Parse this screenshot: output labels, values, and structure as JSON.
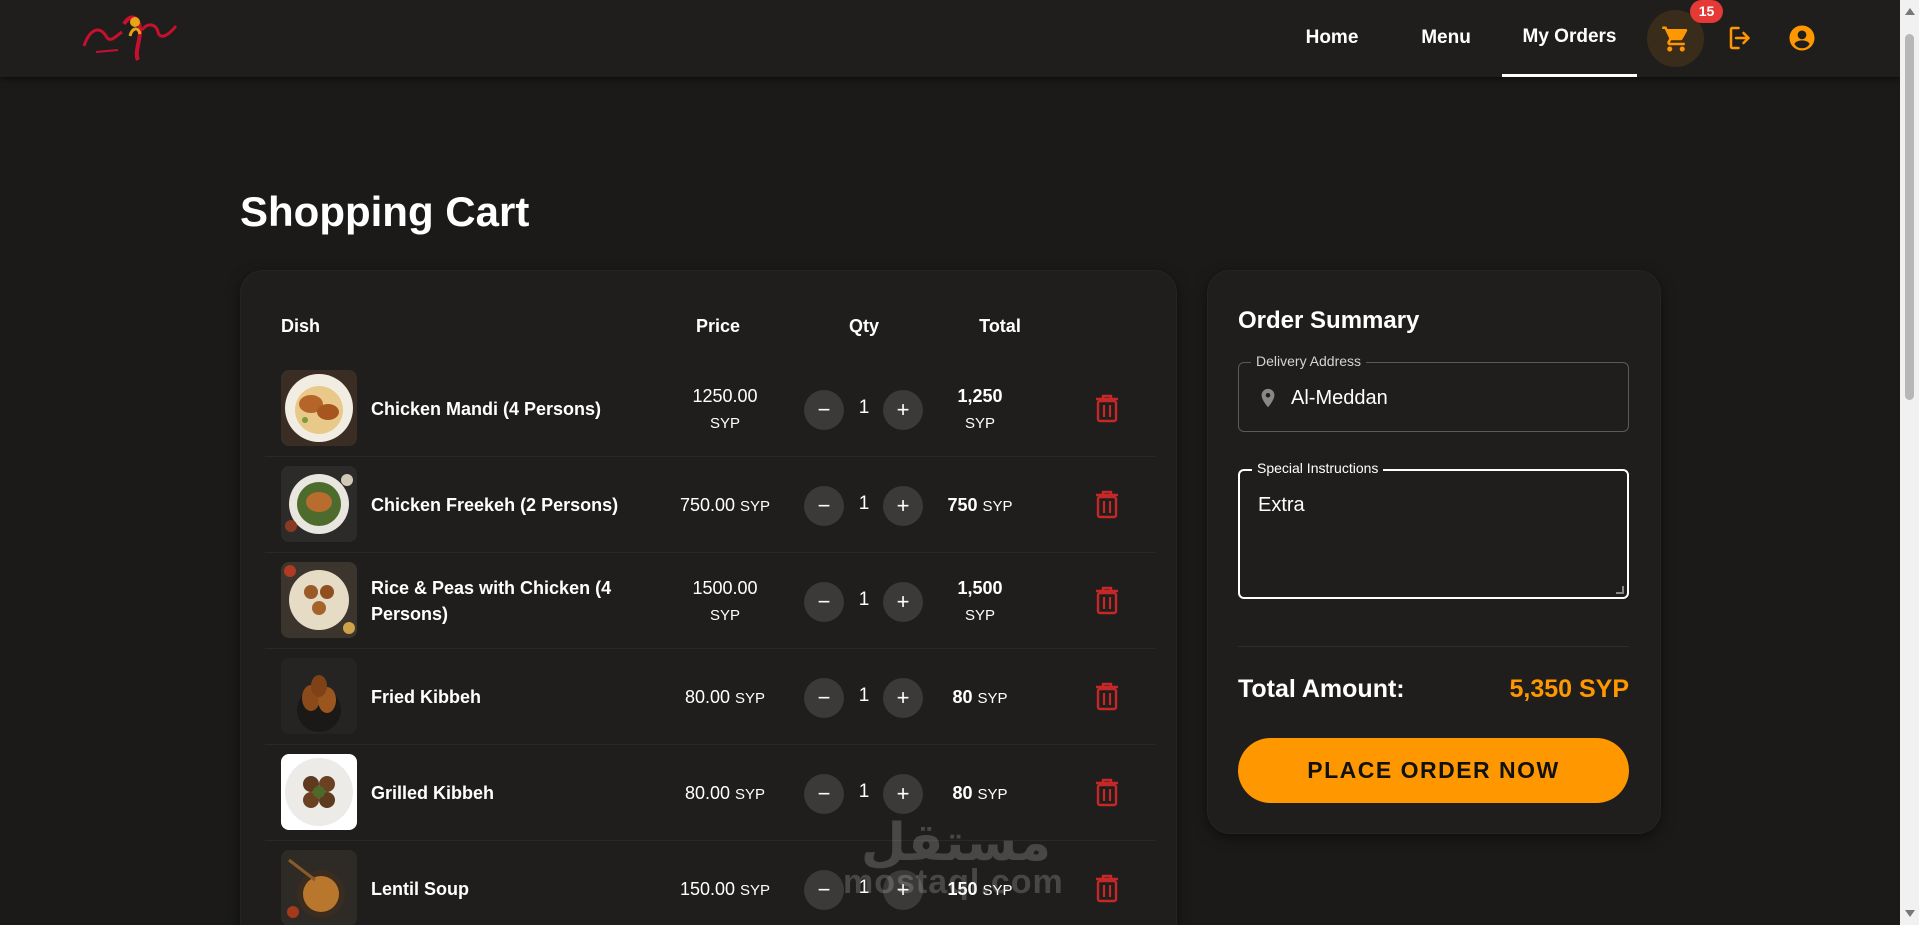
{
  "header": {
    "logo_alt": "restaurant-logo",
    "nav": [
      {
        "label": "Home"
      },
      {
        "label": "Menu"
      },
      {
        "label": "My Orders",
        "active": true
      }
    ],
    "cart_count": "15",
    "icons": [
      "cart-icon",
      "logout-icon",
      "account-circle-icon"
    ]
  },
  "page": {
    "title": "Shopping Cart"
  },
  "cart": {
    "columns": {
      "dish": "Dish",
      "price": "Price",
      "qty": "Qty",
      "total": "Total"
    },
    "currency": "SYP",
    "items": [
      {
        "name": "Chicken Mandi (4 Persons)",
        "price": "1250.00",
        "qty": "1",
        "total": "1,250"
      },
      {
        "name": "Chicken Freekeh (2 Persons)",
        "price": "750.00",
        "qty": "1",
        "total": "750"
      },
      {
        "name": "Rice & Peas with Chicken (4 Persons)",
        "price": "1500.00",
        "qty": "1",
        "total": "1,500"
      },
      {
        "name": "Fried Kibbeh",
        "price": "80.00",
        "qty": "1",
        "total": "80"
      },
      {
        "name": "Grilled Kibbeh",
        "price": "80.00",
        "qty": "1",
        "total": "80"
      },
      {
        "name": "Lentil Soup",
        "price": "150.00",
        "qty": "1",
        "total": "150"
      }
    ],
    "minus": "−",
    "plus": "+"
  },
  "summary": {
    "title": "Order Summary",
    "address_label": "Delivery Address",
    "address_value": "Al-Meddan",
    "instructions_label": "Special Instructions",
    "instructions_value": "Extra",
    "total_label": "Total Amount:",
    "total_value": "5,350 SYP",
    "place_order_label": "PLACE ORDER NOW"
  },
  "watermark": {
    "arabic": "مستقل",
    "latin": "mostaql.com"
  },
  "colors": {
    "background": "#1b1a19",
    "panel": "#1f1e1d",
    "accent": "#ff9800",
    "danger": "#c62828",
    "badge": "#e53935"
  }
}
